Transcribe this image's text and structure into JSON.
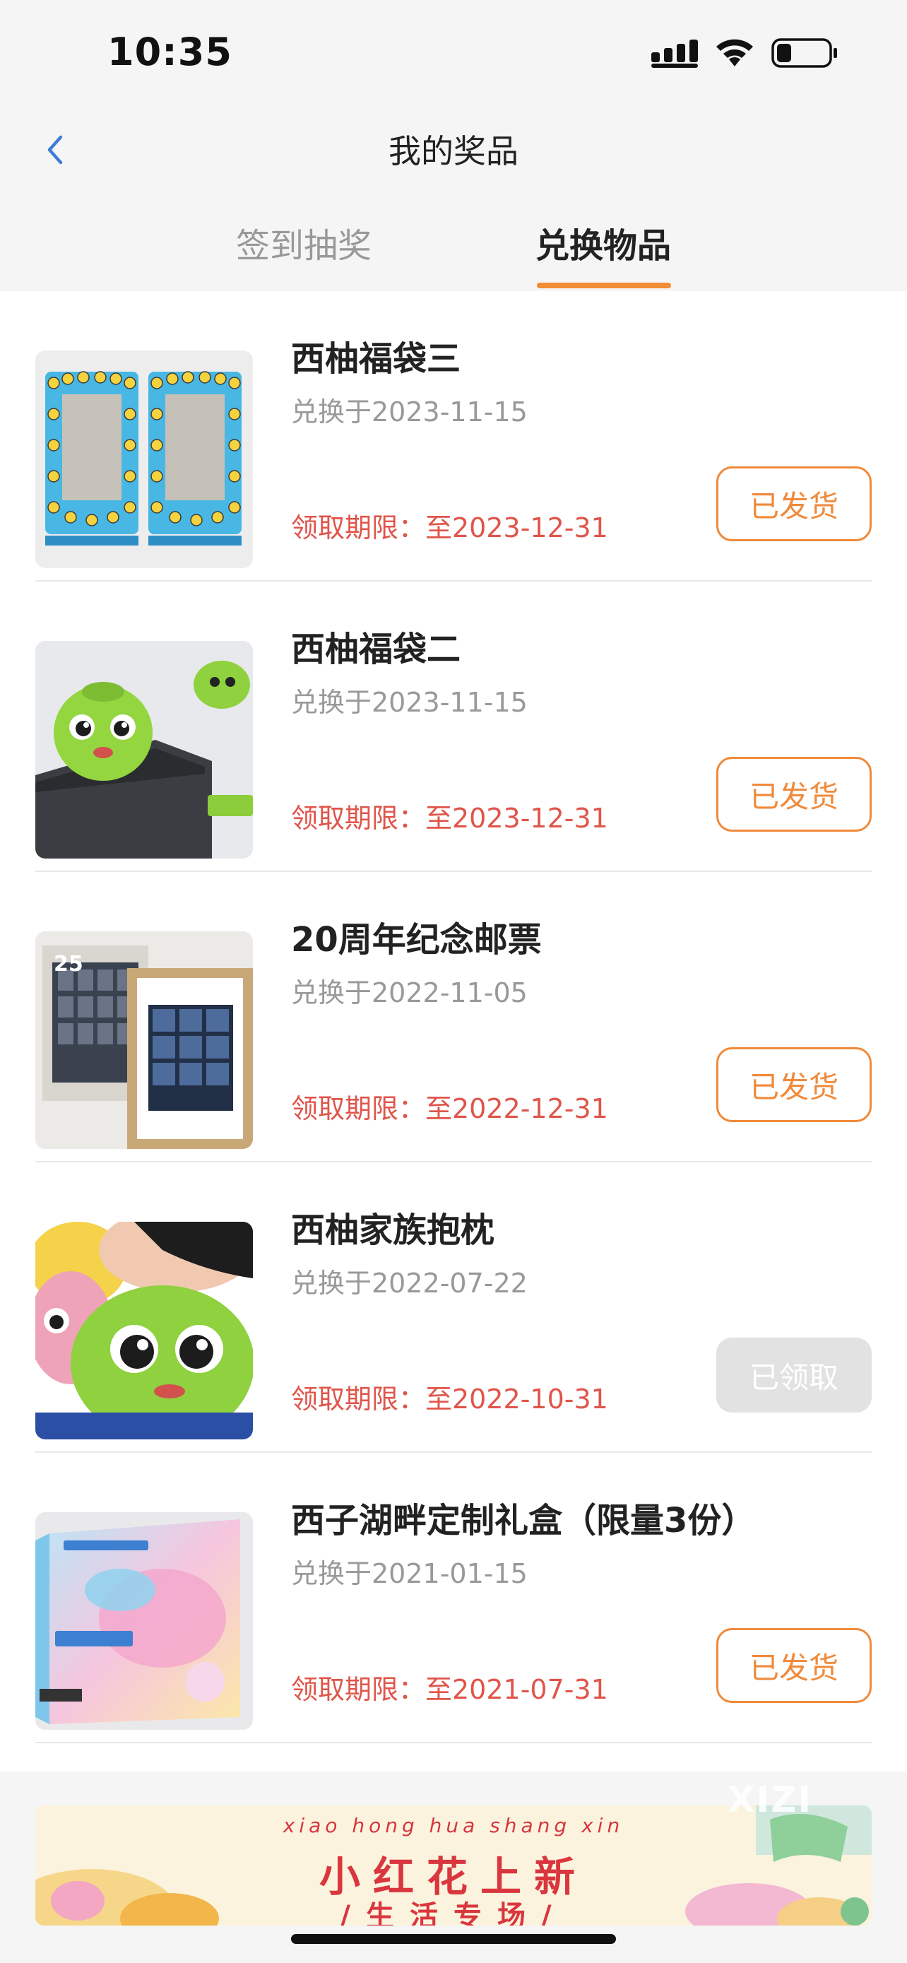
{
  "status_bar": {
    "time": "10:35"
  },
  "header": {
    "title": "我的奖品"
  },
  "tabs": [
    {
      "label": "签到抽奖",
      "active": false
    },
    {
      "label": "兑换物品",
      "active": true
    }
  ],
  "colors": {
    "accent": "#f28c35",
    "deadline": "#e0554a",
    "muted": "#999999",
    "done_button": "#e2e2e2"
  },
  "items": [
    {
      "title": "西柚福袋三",
      "date": "兑换于2023-11-15",
      "deadline": "领取期限：至2023-12-31",
      "status": "已发货",
      "image": "photo-frames"
    },
    {
      "title": "西柚福袋二",
      "date": "兑换于2023-11-15",
      "deadline": "领取期限：至2023-12-31",
      "status": "已发货",
      "image": "green-mascot-usb"
    },
    {
      "title": "20周年纪念邮票",
      "date": "兑换于2022-11-05",
      "deadline": "领取期限：至2022-12-31",
      "status": "已发货",
      "image": "stamp-frame",
      "image_badge": "25"
    },
    {
      "title": "西柚家族抱枕",
      "date": "兑换于2022-07-22",
      "deadline": "领取期限：至2022-10-31",
      "status": "已领取",
      "image": "mascot-pillow"
    },
    {
      "title": "西子湖畔定制礼盒（限量3份）",
      "date": "兑换于2021-01-15",
      "deadline": "领取期限：至2021-07-31",
      "status": "已发货",
      "image": "gift-box"
    }
  ],
  "banner": {
    "pinyin": "xiao hong hua shang xin",
    "title": "小红花上新",
    "subtitle": "/生活专场/"
  },
  "watermark": "XIZI"
}
